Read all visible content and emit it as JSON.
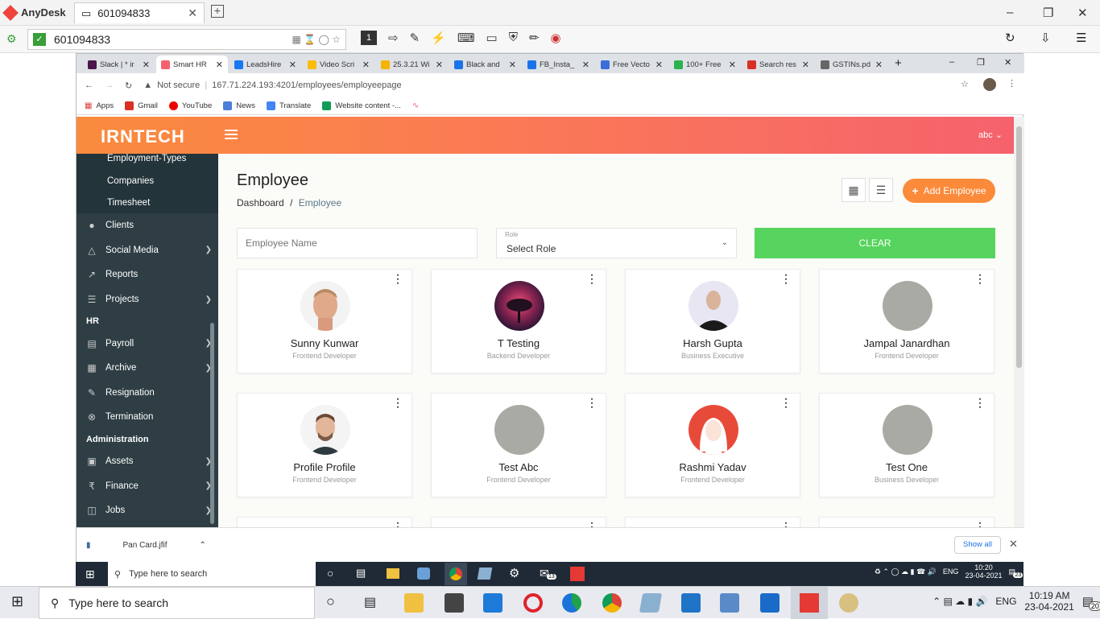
{
  "anydesk": {
    "app_name": "AnyDesk",
    "tab_label": "601094833",
    "address": "601094833",
    "session_number": "1"
  },
  "chrome": {
    "tabs": [
      {
        "label": "Slack | * ir",
        "color": "#4a154b"
      },
      {
        "label": "Smart HR",
        "color": "#f5626d"
      },
      {
        "label": "LeadsHire",
        "color": "#1877f2"
      },
      {
        "label": "Video Scri",
        "color": "#fbbc05"
      },
      {
        "label": "25.3.21 Wi",
        "color": "#f4b400"
      },
      {
        "label": "Black and",
        "color": "#1a73e8"
      },
      {
        "label": "FB_Insta_",
        "color": "#1a73e8"
      },
      {
        "label": "Free Vecto",
        "color": "#3b6ed8"
      },
      {
        "label": "100+ Free",
        "color": "#2bb24c"
      },
      {
        "label": "Search res",
        "color": "#d93025"
      },
      {
        "label": "GSTINs.pd",
        "color": "#666666"
      }
    ],
    "url_security": "Not secure",
    "url": "167.71.224.193:4201/employees/employeepage",
    "bookmarks": [
      "Apps",
      "Gmail",
      "YouTube",
      "News",
      "Translate",
      "Website content -..."
    ]
  },
  "app": {
    "logo": "IRNTECH",
    "user": "abc",
    "sidebar": {
      "sub_items": [
        "Employment-Types",
        "Companies",
        "Timesheet"
      ],
      "clients": "Clients",
      "social_media": "Social Media",
      "reports": "Reports",
      "projects": "Projects",
      "hr_head": "HR",
      "payroll": "Payroll",
      "archive": "Archive",
      "resignation": "Resignation",
      "termination": "Termination",
      "admin_head": "Administration",
      "assets": "Assets",
      "finance": "Finance",
      "jobs": "Jobs"
    },
    "page_title": "Employee",
    "breadcrumb": {
      "home": "Dashboard",
      "sep": "/",
      "current": "Employee"
    },
    "add_button": "Add Employee",
    "filters": {
      "name_placeholder": "Employee Name",
      "role_label": "Role",
      "role_value": "Select Role",
      "clear": "CLEAR"
    },
    "employees": [
      {
        "name": "Sunny Kunwar",
        "role": "Frontend Developer"
      },
      {
        "name": "T Testing",
        "role": "Backend Developer"
      },
      {
        "name": "Harsh Gupta",
        "role": "Business Executive"
      },
      {
        "name": "Jampal Janardhan",
        "role": "Frontend Developer"
      },
      {
        "name": "Profile Profile",
        "role": "Frontend Developer"
      },
      {
        "name": "Test Abc",
        "role": "Frontend Developer"
      },
      {
        "name": "Rashmi Yadav",
        "role": "Frontend Developer"
      },
      {
        "name": "Test One",
        "role": "Business Developer"
      }
    ]
  },
  "download": {
    "file": "Pan Card.jfif",
    "show_all": "Show all"
  },
  "inner_taskbar": {
    "search": "Type here to search",
    "lang": "ENG",
    "time": "10:20",
    "date": "23-04-2021",
    "badge": "23",
    "mail_count": "13"
  },
  "outer_taskbar": {
    "search": "Type here to search",
    "lang": "ENG",
    "time": "10:19 AM",
    "date": "23-04-2021",
    "badge": "20"
  }
}
